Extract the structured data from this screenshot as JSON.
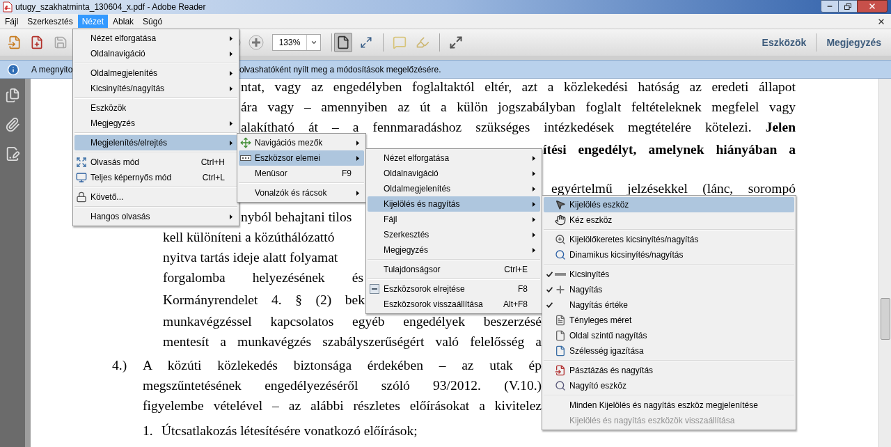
{
  "window": {
    "title": "utugy_szakhatminta_130604_x.pdf - Adobe Reader"
  },
  "menubar": [
    {
      "label": "Fájl",
      "selected": false
    },
    {
      "label": "Szerkesztés",
      "selected": false
    },
    {
      "label": "Nézet",
      "selected": true
    },
    {
      "label": "Ablak",
      "selected": false
    },
    {
      "label": "Súgó",
      "selected": false
    }
  ],
  "toolbar": {
    "zoom": "133%",
    "panel_buttons": [
      "Eszközök",
      "Megjegyzés"
    ]
  },
  "info_bar": {
    "text_start": "A megnyito",
    "text_end": "olvashatóként nyílt meg a módosítások megelőzésére."
  },
  "document": {
    "lines": [
      {
        "kind": "plain",
        "text": "ntat, vagy az engedélyben foglaltaktól eltér, azt a közlekedési hatóság az eredeti állapot"
      },
      {
        "kind": "plain",
        "text": "ára vagy – amennyiben az út a külön jogszabályban foglalt feltételeknek megfelel vagy"
      },
      {
        "kind": "plain",
        "text": "alakítható át – a fennmaradáshoz szükséges intézkedések megtételére kötelezi. **Jelen**"
      },
      {
        "kind": "bold",
        "text": "ítési engedélyt, amelynek hiányában a"
      },
      {
        "kind": "plain",
        "text": "egyértelmű jelzésekkel (lánc, sorompó"
      },
      {
        "kind": "plain",
        "text": "nyból behajtani tilos"
      },
      {
        "kind": "plain",
        "text": "kell különíteni a közúthálózattó"
      },
      {
        "kind": "plain",
        "text": "nyitva tartás ideje alatt folyamat"
      },
      {
        "kind": "plain",
        "text": "forgalomba helyezésének és"
      },
      {
        "kind": "plain",
        "text": "Kormányrendelet 4. § (2) bek"
      },
      {
        "kind": "plain",
        "text": "munkavégzéssel kapcsolatos egyéb engedélyek beszerzésé"
      },
      {
        "kind": "plain",
        "text": "mentesít a munkavégzés szabályszerűségért való felelősség a"
      },
      {
        "kind": "plain",
        "number": "4.)",
        "text": "A közúti közlekedés biztonsága érdekében – az utak ép"
      },
      {
        "kind": "plain",
        "text": "megszűntetésének engedélyezéséről szóló 93/2012. (V.10.)"
      },
      {
        "kind": "plain",
        "text": "figyelembe vételével – az alábbi részletes előírásokat a kivitelez"
      },
      {
        "kind": "plain",
        "number": "1.",
        "text": "Útcsatlakozás létesítésére vonatkozó előírások;"
      }
    ]
  },
  "menus": [
    {
      "items": [
        {
          "kind": "item",
          "label": "Nézet elforgatása",
          "submenu": true,
          "selected": false
        },
        {
          "kind": "item",
          "label": "Oldalnavigáció",
          "submenu": true,
          "selected": false
        },
        {
          "kind": "separator"
        },
        {
          "kind": "item",
          "label": "Oldalmegjelenítés",
          "submenu": true,
          "selected": false
        },
        {
          "kind": "item",
          "label": "Kicsinyítés/nagyítás",
          "submenu": true,
          "selected": false
        },
        {
          "kind": "separator"
        },
        {
          "kind": "item",
          "label": "Eszközök",
          "submenu": false,
          "selected": false
        },
        {
          "kind": "item",
          "label": "Megjegyzés",
          "submenu": true,
          "selected": false
        },
        {
          "kind": "separator"
        },
        {
          "kind": "item",
          "label": "Megjelenítés/elrejtés",
          "submenu": true,
          "selected": true
        },
        {
          "kind": "separator"
        },
        {
          "kind": "item",
          "label": "Olvasás mód",
          "shortcut": "Ctrl+H",
          "submenu": false,
          "selected": false
        },
        {
          "kind": "item",
          "label": "Teljes képernyős mód",
          "shortcut": "Ctrl+L",
          "submenu": false,
          "selected": false
        },
        {
          "kind": "separator"
        },
        {
          "kind": "item",
          "label": "Követő...",
          "submenu": false,
          "selected": false
        },
        {
          "kind": "separator"
        },
        {
          "kind": "item",
          "label": "Hangos olvasás",
          "submenu": true,
          "selected": false
        }
      ]
    },
    {
      "items": [
        {
          "kind": "item",
          "label": "Navigációs mezők",
          "submenu": true,
          "selected": false
        },
        {
          "kind": "item",
          "label": "Eszközsor elemei",
          "submenu": true,
          "selected": true
        },
        {
          "kind": "item",
          "label": "Menüsor",
          "shortcut": "F9",
          "submenu": false,
          "selected": false
        },
        {
          "kind": "separator"
        },
        {
          "kind": "item",
          "label": "Vonalzók és rácsok",
          "submenu": true,
          "selected": false
        }
      ]
    },
    {
      "items": [
        {
          "kind": "item",
          "label": "Nézet elforgatása",
          "submenu": true,
          "selected": false
        },
        {
          "kind": "item",
          "label": "Oldalnavigáció",
          "submenu": true,
          "selected": false
        },
        {
          "kind": "item",
          "label": "Oldalmegjelenítés",
          "submenu": true,
          "selected": false
        },
        {
          "kind": "item",
          "label": "Kijelölés és nagyítás",
          "submenu": true,
          "selected": true
        },
        {
          "kind": "item",
          "label": "Fájl",
          "submenu": true,
          "selected": false
        },
        {
          "kind": "item",
          "label": "Szerkesztés",
          "submenu": true,
          "selected": false
        },
        {
          "kind": "item",
          "label": "Megjegyzés",
          "submenu": true,
          "selected": false
        },
        {
          "kind": "separator"
        },
        {
          "kind": "item",
          "label": "Tulajdonságsor",
          "shortcut": "Ctrl+E",
          "submenu": false,
          "selected": false
        },
        {
          "kind": "separator"
        },
        {
          "kind": "item",
          "label": "Eszközsorok elrejtése",
          "shortcut": "F8",
          "submenu": false,
          "selected": false
        },
        {
          "kind": "item",
          "label": "Eszközsorok visszaállítása",
          "shortcut": "Alt+F8",
          "submenu": false,
          "selected": false
        }
      ]
    },
    {
      "items": [
        {
          "kind": "item",
          "label": "Kijelölés eszköz",
          "submenu": false,
          "selected": true,
          "checked": false,
          "disabled": false
        },
        {
          "kind": "item",
          "label": "Kéz eszköz",
          "submenu": false,
          "selected": false,
          "checked": false,
          "disabled": false
        },
        {
          "kind": "separator"
        },
        {
          "kind": "item",
          "label": "Kijelölőkeretes kicsinyítés/nagyítás",
          "submenu": false,
          "selected": false,
          "checked": false,
          "disabled": false
        },
        {
          "kind": "item",
          "label": "Dinamikus kicsinyítés/nagyítás",
          "submenu": false,
          "selected": false,
          "checked": false,
          "disabled": false
        },
        {
          "kind": "separator"
        },
        {
          "kind": "item",
          "label": "Kicsinyítés",
          "submenu": false,
          "selected": false,
          "checked": true,
          "disabled": false
        },
        {
          "kind": "item",
          "label": "Nagyítás",
          "submenu": false,
          "selected": false,
          "checked": true,
          "disabled": false
        },
        {
          "kind": "item",
          "label": "Nagyítás értéke",
          "submenu": false,
          "selected": false,
          "checked": true,
          "disabled": false
        },
        {
          "kind": "item",
          "label": "Tényleges méret",
          "submenu": false,
          "selected": false,
          "checked": false,
          "disabled": false
        },
        {
          "kind": "item",
          "label": "Oldal szintű nagyítás",
          "submenu": false,
          "selected": false,
          "checked": false,
          "disabled": false
        },
        {
          "kind": "item",
          "label": "Szélesség igazítása",
          "submenu": false,
          "selected": false,
          "checked": false,
          "disabled": false
        },
        {
          "kind": "separator"
        },
        {
          "kind": "item",
          "label": "Pásztázás és nagyítás",
          "submenu": false,
          "selected": false,
          "checked": false,
          "disabled": false
        },
        {
          "kind": "item",
          "label": "Nagyító eszköz",
          "submenu": false,
          "selected": false,
          "checked": false,
          "disabled": false
        },
        {
          "kind": "separator"
        },
        {
          "kind": "item",
          "label": "Minden Kijelölés és nagyítás eszköz megjelenítése",
          "submenu": false,
          "selected": false,
          "checked": false,
          "disabled": false
        },
        {
          "kind": "item",
          "label": "Kijelölés és nagyítás eszközök visszaállítása",
          "submenu": false,
          "selected": false,
          "checked": false,
          "disabled": true
        }
      ]
    }
  ]
}
